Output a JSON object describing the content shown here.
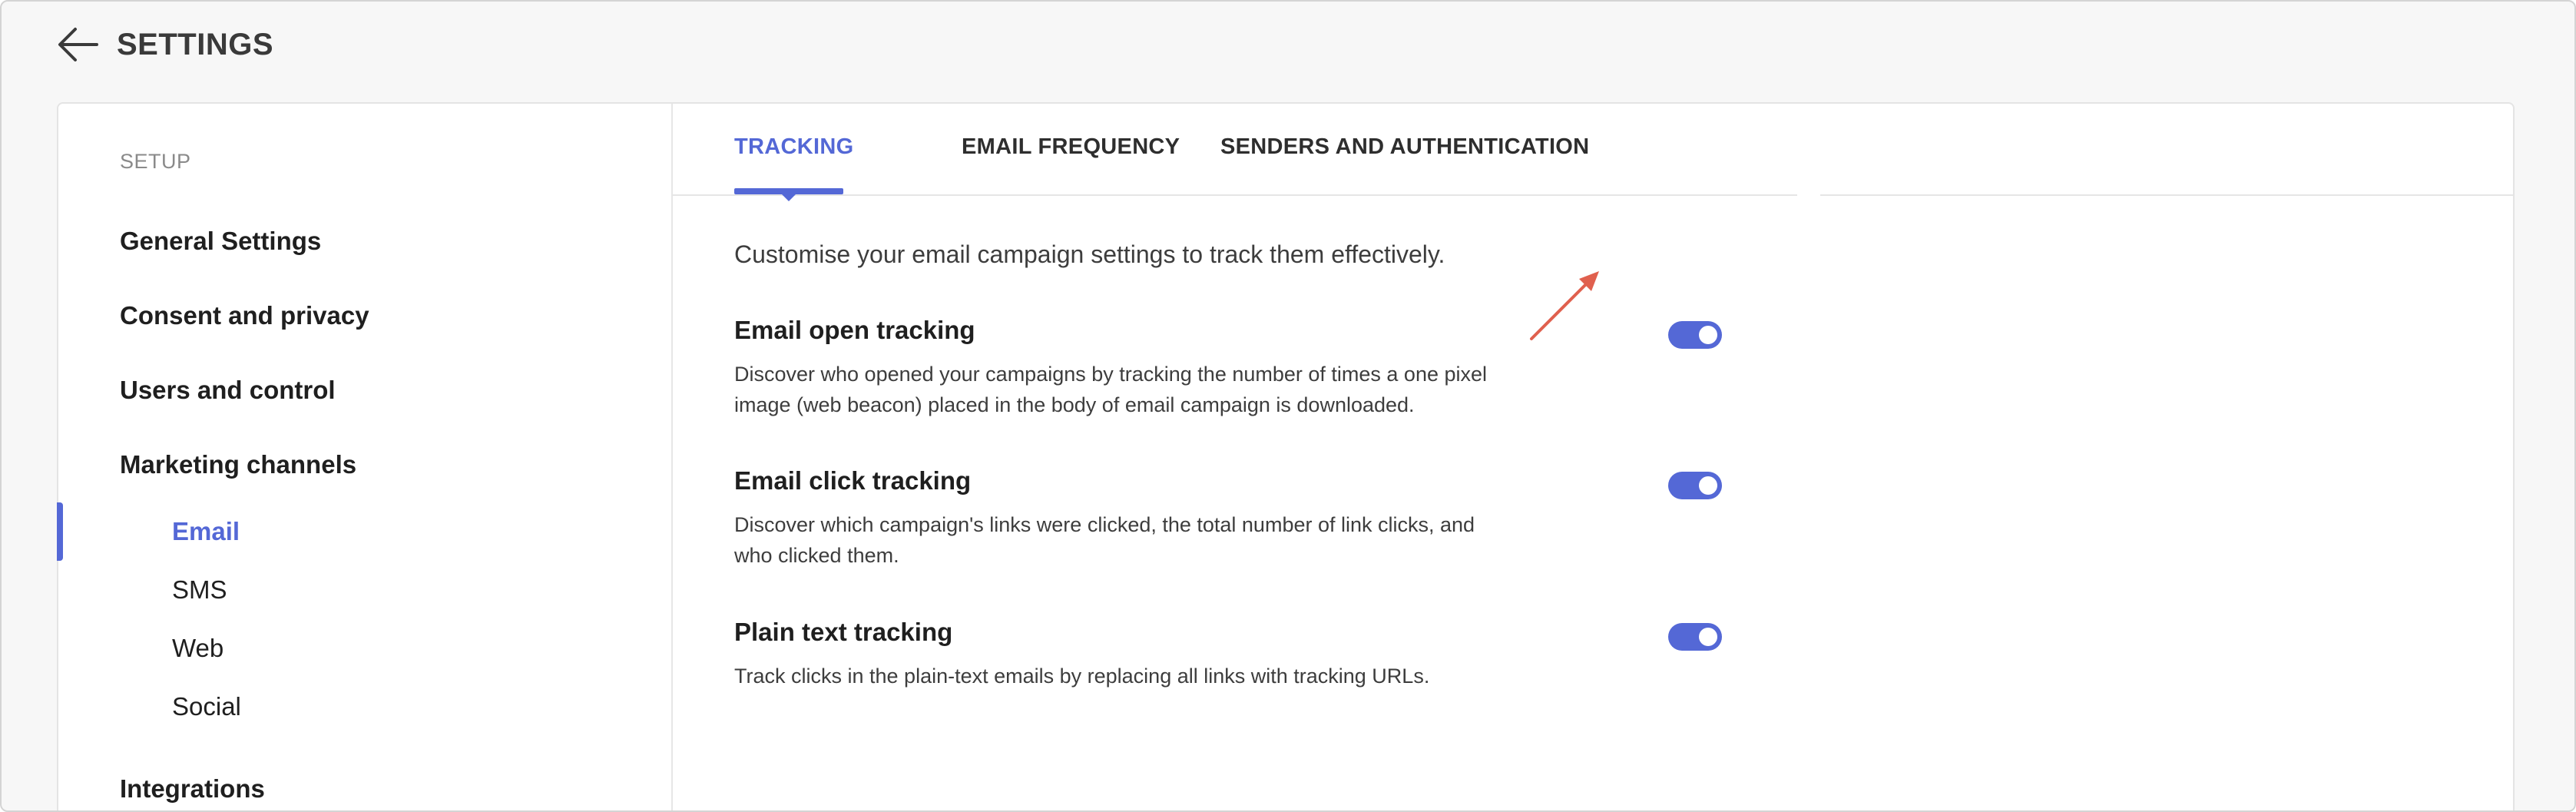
{
  "header": {
    "title": "SETTINGS",
    "back_icon": "arrow-left-icon"
  },
  "sidebar": {
    "heading": "SETUP",
    "items": [
      {
        "label": "General Settings"
      },
      {
        "label": "Consent and privacy"
      },
      {
        "label": "Users and control"
      },
      {
        "label": "Marketing channels"
      }
    ],
    "subitems": [
      {
        "label": "Email",
        "active": true
      },
      {
        "label": "SMS"
      },
      {
        "label": "Web"
      },
      {
        "label": "Social"
      }
    ],
    "bottom_item": "Integrations"
  },
  "tabs": [
    {
      "label": "TRACKING",
      "active": true
    },
    {
      "label": "EMAIL FREQUENCY"
    },
    {
      "label": "SENDERS AND AUTHENTICATION"
    }
  ],
  "intro": "Customise your email campaign settings to track them effectively.",
  "settings": [
    {
      "title": "Email open tracking",
      "description": "Discover who opened your campaigns by tracking the number of times a one pixel image (web beacon) placed in the body of email campaign is downloaded.",
      "enabled": true
    },
    {
      "title": "Email click tracking",
      "description": "Discover which campaign's links were clicked, the total number of link clicks, and who clicked them.",
      "enabled": true
    },
    {
      "title": "Plain text tracking",
      "description": "Track clicks in the plain-text emails by replacing all links with tracking URLs.",
      "enabled": true
    }
  ],
  "colors": {
    "accent": "#5468d6",
    "annotation": "#e0604e",
    "background": "#f7f7f7"
  }
}
